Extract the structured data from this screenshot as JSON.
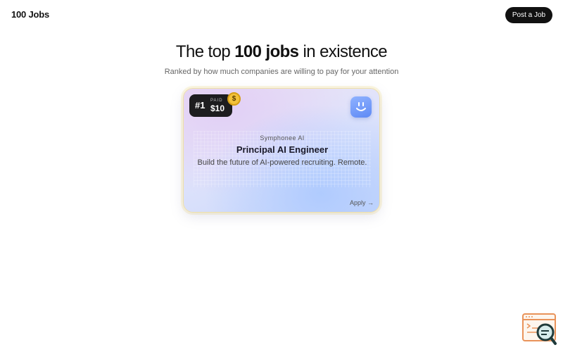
{
  "header": {
    "brand": "100 Jobs",
    "post_button": "Post a Job"
  },
  "hero": {
    "title_pre": "The top",
    "title_bold": "100 jobs",
    "title_post": "in existence",
    "subtitle": "Ranked by how much companies are willing to pay for your attention"
  },
  "card": {
    "rank": "#1",
    "paid_label": "PAID",
    "paid_amount": "$10",
    "coin_symbol": "$",
    "company": "Symphonee AI",
    "role": "Principal AI Engineer",
    "description": "Build the future of AI-powered recruiting. Remote.",
    "apply_label": "Apply →",
    "logo_icon": "smile-face-icon",
    "coin_icon": "dollar-coin-icon"
  },
  "widget": {
    "icon": "search-code-icon"
  },
  "colors": {
    "brand_dark": "#111111",
    "coin": "#f2c23a",
    "logo_blue": "#6f96f8"
  }
}
